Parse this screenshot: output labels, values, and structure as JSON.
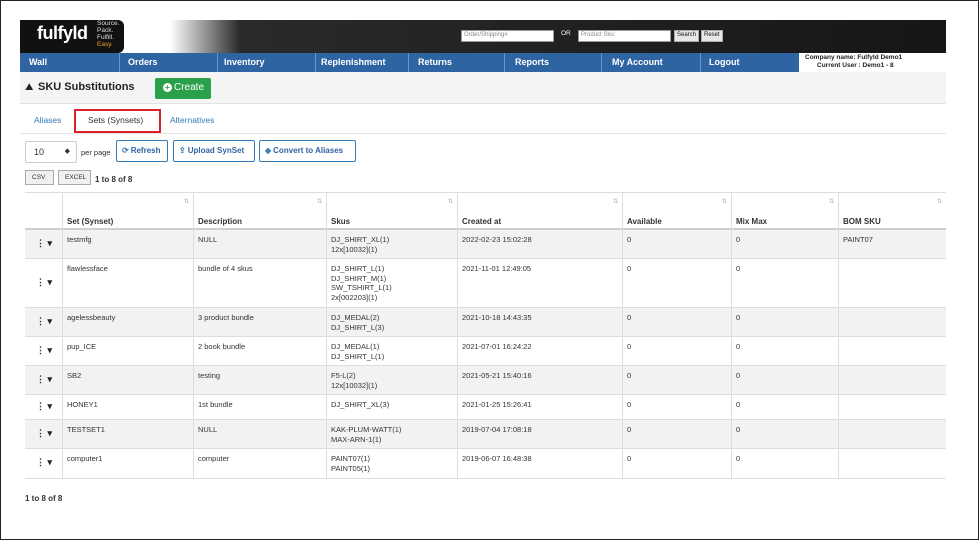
{
  "brand": {
    "logo_text": "fulfyld",
    "tagline": [
      "Source.",
      "Pack.",
      "Fulfill.",
      "Easy."
    ]
  },
  "search": {
    "order_placeholder": "Order/Shipping#",
    "or_label": "OR",
    "sku_placeholder": "Product Sku:",
    "search_label": "Search",
    "reset_label": "Reset"
  },
  "nav": {
    "items": [
      {
        "label": "Wall"
      },
      {
        "label": "Orders"
      },
      {
        "label": "Inventory"
      },
      {
        "label": "Replenishment"
      },
      {
        "label": "Returns"
      },
      {
        "label": "Reports"
      },
      {
        "label": "My Account"
      },
      {
        "label": "Logout"
      }
    ],
    "company": "Company name: Fulfyld Demo1",
    "user": "Current User : Demo1 - 8"
  },
  "header": {
    "title": "SKU Substitutions",
    "create_label": "Create"
  },
  "tabs": [
    {
      "label": "Aliases"
    },
    {
      "label": "Sets (Synsets)"
    },
    {
      "label": "Alternatives"
    }
  ],
  "controls": {
    "page_size": "10",
    "per_page_label": "per page",
    "refresh_label": "Refresh",
    "upload_label": "Upload SynSet",
    "convert_label": "Convert to Aliases",
    "csv_label": "CSV",
    "excel_label": "EXCEL",
    "count_text": "1 to 8 of 8"
  },
  "table": {
    "columns": [
      "Set (Synset)",
      "Description",
      "Skus",
      "Created at",
      "Available",
      "Mix Max",
      "BOM SKU"
    ],
    "rows": [
      {
        "set": "testmfg",
        "description": "NULL",
        "skus": [
          "DJ_SHIRT_XL(1)",
          "12x[10032](1)"
        ],
        "created": "2022-02-23 15:02:28",
        "available": "0",
        "mixmax": "0",
        "bom": "PAINT07"
      },
      {
        "set": "flawlessface",
        "description": "bundle of 4 skus",
        "skus": [
          "DJ_SHIRT_L(1)",
          "DJ_SHIRT_M(1)",
          "SW_TSHIRT_L(1)",
          "2x[002203](1)"
        ],
        "created": "2021-11-01 12:49:05",
        "available": "0",
        "mixmax": "0",
        "bom": ""
      },
      {
        "set": "agelessbeauty",
        "description": "3 product bundle",
        "skus": [
          "DJ_MEDAL(2)",
          "DJ_SHIRT_L(3)"
        ],
        "created": "2021-10-18 14:43:35",
        "available": "0",
        "mixmax": "0",
        "bom": ""
      },
      {
        "set": "pup_ICE",
        "description": "2 book bundle",
        "skus": [
          "DJ_MEDAL(1)",
          "DJ_SHIRT_L(1)"
        ],
        "created": "2021-07-01 16:24:22",
        "available": "0",
        "mixmax": "0",
        "bom": ""
      },
      {
        "set": "SB2",
        "description": "testing",
        "skus": [
          "F5-L(2)",
          "12x[10032](1)"
        ],
        "created": "2021-05-21 15:40:16",
        "available": "0",
        "mixmax": "0",
        "bom": ""
      },
      {
        "set": "HONEY1",
        "description": "1st bundle",
        "skus": [
          "DJ_SHIRT_XL(3)"
        ],
        "created": "2021-01-25 15:26:41",
        "available": "0",
        "mixmax": "0",
        "bom": ""
      },
      {
        "set": "TESTSET1",
        "description": "NULL",
        "skus": [
          "KAK-PLUM-WATT(1)",
          "MAX-ARN-1(1)"
        ],
        "created": "2019-07-04 17:08:18",
        "available": "0",
        "mixmax": "0",
        "bom": ""
      },
      {
        "set": "computer1",
        "description": "computer",
        "skus": [
          "PAINT07(1)",
          "PAINT05(1)"
        ],
        "created": "2019-06-07 16:48:38",
        "available": "0",
        "mixmax": "0",
        "bom": ""
      }
    ]
  },
  "colors": {
    "nav": "#2f64a2",
    "create": "#2aa04a",
    "link": "#337ab7",
    "highlight": "#d9232a"
  }
}
